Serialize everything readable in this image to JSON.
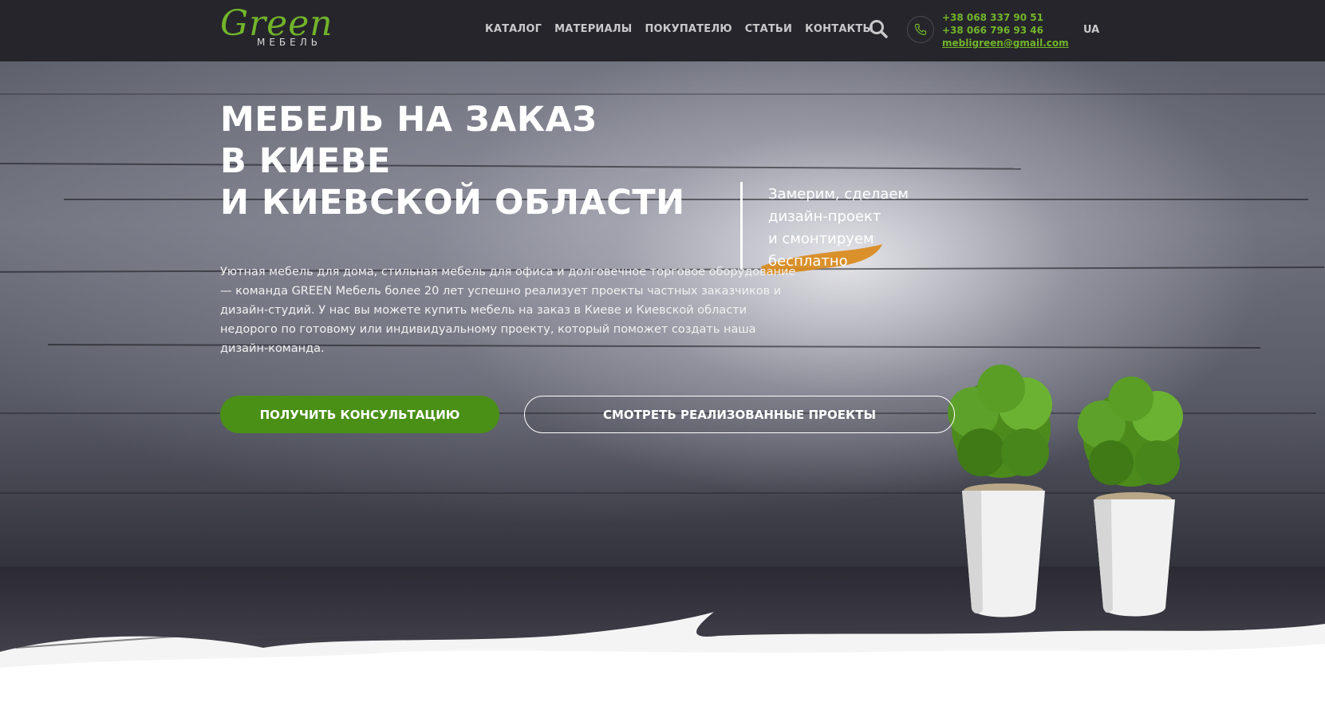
{
  "header": {
    "logo_word": "Green",
    "logo_sub": "МЕБЕЛЬ",
    "nav": [
      "КАТАЛОГ",
      "МАТЕРИАЛЫ",
      "ПОКУПАТЕЛЮ",
      "СТАТЬИ",
      "КОНТАКТЫ"
    ],
    "phone_1": "+38 068 337 90 51",
    "phone_2": "+38 066 796 93 46",
    "email": "mebligreen@gmail.com",
    "lang": "UA",
    "search_icon": "search-icon",
    "phone_icon": "phone-icon"
  },
  "hero": {
    "title_lines": [
      "МЕБЕЛЬ НА ЗАКАЗ",
      "В КИЕВЕ",
      "И КИЕВСКОЙ ОБЛАСТИ"
    ],
    "side_lines": [
      "Замерим, сделаем",
      "дизайн-проект",
      "и смонтируем",
      "бесплатно"
    ],
    "description": "Уютная мебель для дома, стильная мебель для офиса и долговечное торговое оборудование — команда GREEN Мебель более 20 лет успешно реализует проекты частных заказчиков и дизайн-студий. У нас вы можете купить мебель на заказ в Киеве и Киевской области недорого по готовому или индивидуальному проекту, который поможет создать наша дизайн-команда.",
    "cta_primary": "ПОЛУЧИТЬ КОНСУЛЬТАЦИЮ",
    "cta_secondary": "СМОТРЕТЬ РЕАЛИЗОВАННЫЕ ПРОЕКТЫ"
  },
  "colors": {
    "brand_green": "#72b52a",
    "button_green": "#4a9017",
    "header_bg": "#26252b",
    "accent_orange": "#d98a1c"
  }
}
